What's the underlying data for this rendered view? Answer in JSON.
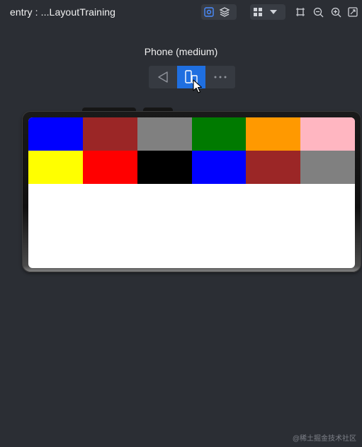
{
  "toolbar": {
    "title": "entry : ...LayoutTraining",
    "icons": [
      "inspector-icon",
      "layers-icon",
      "components-icon",
      "dropdown-icon",
      "frame-icon",
      "zoom-out-icon",
      "zoom-in-icon",
      "fit-icon"
    ]
  },
  "preview": {
    "device_name": "Phone (medium)",
    "controls": [
      "rotate-icon",
      "device-icon",
      "more-icon"
    ]
  },
  "screen": {
    "background": "#ffffff",
    "cells": [
      {
        "color": "#0000ff"
      },
      {
        "color": "#9b2626"
      },
      {
        "color": "#808080"
      },
      {
        "color": "#007a00"
      },
      {
        "color": "#ff9900"
      },
      {
        "color": "#ffb6c1"
      },
      {
        "color": "#ffff00"
      },
      {
        "color": "#ff0000"
      },
      {
        "color": "#000000"
      },
      {
        "color": "#0000ff"
      },
      {
        "color": "#9b2626"
      },
      {
        "color": "#808080"
      }
    ]
  },
  "watermark": "@稀土掘金技术社区",
  "colors": {
    "background": "#2b2e34",
    "accent": "#1f6fe0"
  }
}
